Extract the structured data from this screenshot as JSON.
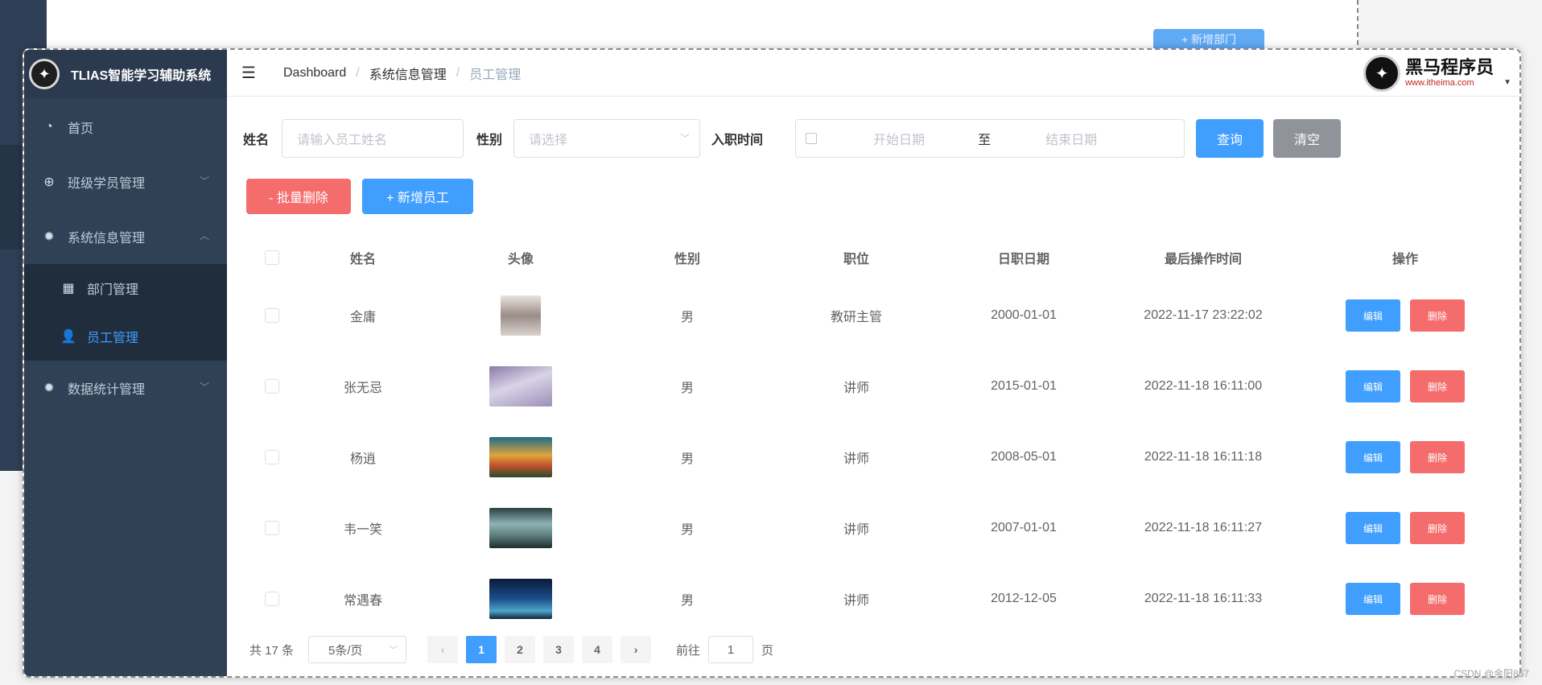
{
  "background": {
    "button_label": "+ 新增部门"
  },
  "app": {
    "title": "TLIAS智能学习辅助系统"
  },
  "sidebar": {
    "items": [
      {
        "label": "首页",
        "icon": "dashboard-icon"
      },
      {
        "label": "班级学员管理",
        "icon": "plus-circle-icon"
      },
      {
        "label": "系统信息管理",
        "icon": "gear-icon"
      },
      {
        "label": "部门管理",
        "icon": "grid-icon"
      },
      {
        "label": "员工管理",
        "icon": "user-icon"
      },
      {
        "label": "数据统计管理",
        "icon": "gear-icon"
      }
    ]
  },
  "header": {
    "breadcrumb": [
      "Dashboard",
      "系统信息管理",
      "员工管理"
    ],
    "brand_name": "黑马程序员",
    "brand_url": "www.itheima.com"
  },
  "search": {
    "name_label": "姓名",
    "name_placeholder": "请输入员工姓名",
    "gender_label": "性别",
    "gender_placeholder": "请选择",
    "date_label": "入职时间",
    "date_start_placeholder": "开始日期",
    "date_separator": "至",
    "date_end_placeholder": "结束日期",
    "query_label": "查询",
    "clear_label": "清空"
  },
  "actions": {
    "batch_delete_label": "- 批量删除",
    "add_label": "+ 新增员工"
  },
  "table": {
    "headers": [
      "姓名",
      "头像",
      "性别",
      "职位",
      "日职日期",
      "最后操作时间",
      "操作"
    ],
    "rows": [
      {
        "name": "金庸",
        "gender": "男",
        "job": "教研主管",
        "entry_date": "2000-01-01",
        "update_time": "2022-11-17 23:22:02"
      },
      {
        "name": "张无忌",
        "gender": "男",
        "job": "讲师",
        "entry_date": "2015-01-01",
        "update_time": "2022-11-18 16:11:00"
      },
      {
        "name": "杨逍",
        "gender": "男",
        "job": "讲师",
        "entry_date": "2008-05-01",
        "update_time": "2022-11-18 16:11:18"
      },
      {
        "name": "韦一笑",
        "gender": "男",
        "job": "讲师",
        "entry_date": "2007-01-01",
        "update_time": "2022-11-18 16:11:27"
      },
      {
        "name": "常遇春",
        "gender": "男",
        "job": "讲师",
        "entry_date": "2012-12-05",
        "update_time": "2022-11-18 16:11:33"
      }
    ],
    "edit_label": "编辑",
    "delete_label": "删除"
  },
  "pagination": {
    "total_text": "共 17 条",
    "page_size": "5条/页",
    "pages": [
      "1",
      "2",
      "3",
      "4"
    ],
    "current_page": "1",
    "goto_prefix": "前往",
    "goto_value": "1",
    "goto_suffix": "页"
  },
  "watermark": "CSDN @余阳867",
  "colors": {
    "sidebar": "#304156",
    "primary": "#409eff",
    "danger": "#f56c6c",
    "info": "#909399"
  }
}
